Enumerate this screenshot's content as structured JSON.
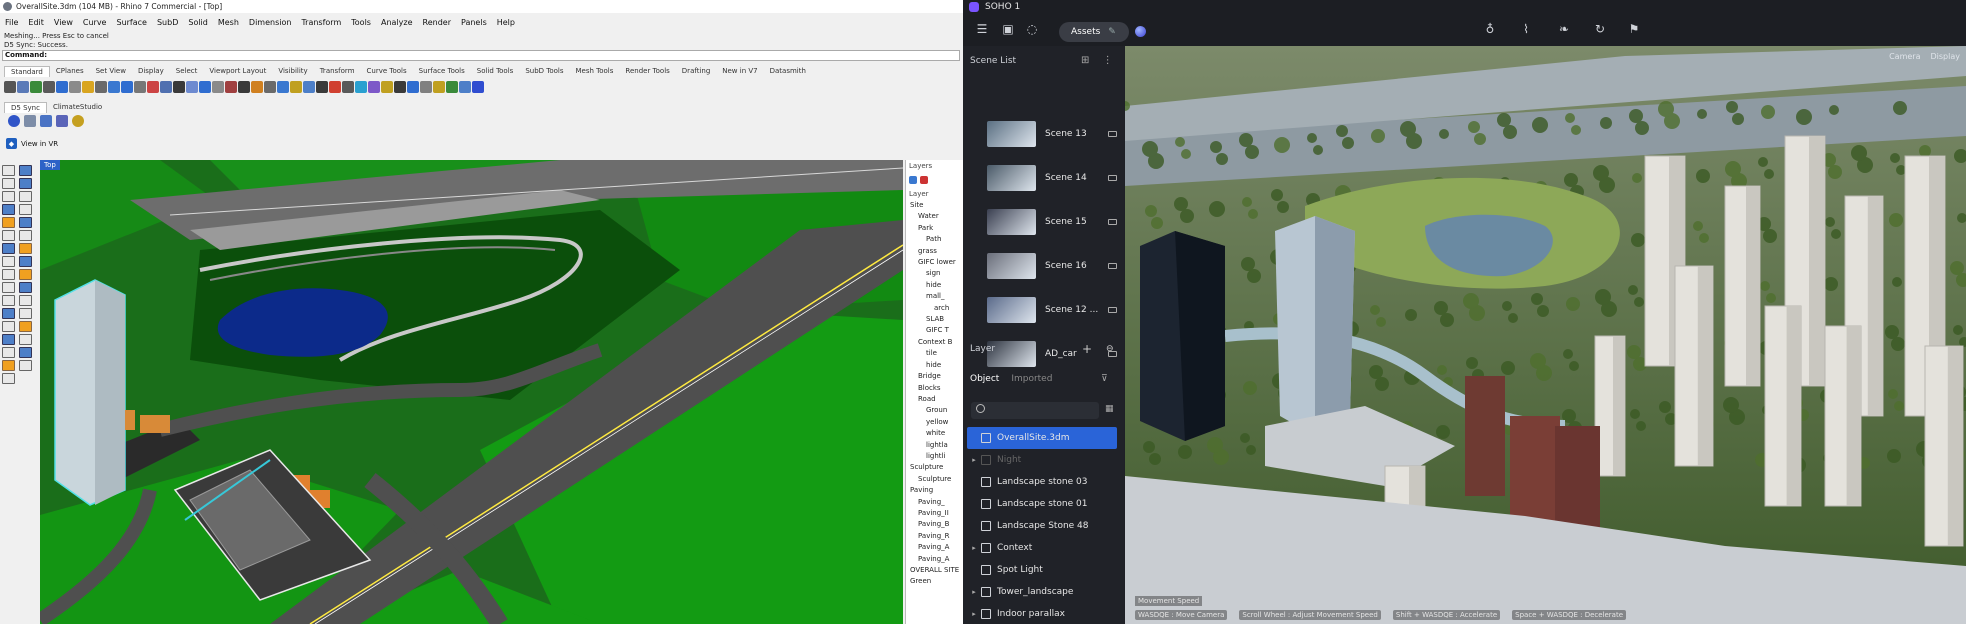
{
  "rhino": {
    "title": "OverallSite.3dm (104 MB) - Rhino 7 Commercial - [Top]",
    "menu": [
      "File",
      "Edit",
      "View",
      "Curve",
      "Surface",
      "SubD",
      "Solid",
      "Mesh",
      "Dimension",
      "Transform",
      "Tools",
      "Analyze",
      "Render",
      "Panels",
      "Help"
    ],
    "history": [
      "Meshing... Press Esc to cancel",
      "D5 Sync: Success."
    ],
    "command_prompt": "Command:",
    "toolbar_tabs": [
      "Standard",
      "CPlanes",
      "Set View",
      "Display",
      "Select",
      "Viewport Layout",
      "Visibility",
      "Transform",
      "Curve Tools",
      "Surface Tools",
      "Solid Tools",
      "SubD Tools",
      "Mesh Tools",
      "Render Tools",
      "Drafting",
      "New in V7",
      "Datasmith"
    ],
    "plugin_tabs": [
      "D5 Sync",
      "ClimateStudio"
    ],
    "vr_label": "View in VR",
    "viewport_label": "Top",
    "layers_panel": {
      "title": "Layers",
      "column": "Layer",
      "rows": [
        "Site",
        "Water",
        "Park",
        "Path",
        "grass",
        "GIFC lower",
        "sign",
        "hide",
        "mall_",
        "arch",
        "SLAB",
        "GIFC T",
        "Context B",
        "tile",
        "hide",
        "Bridge",
        "Blocks",
        "Road",
        "Groun",
        "yellow",
        "white",
        "lightla",
        "lightli",
        "Sculpture",
        "Sculpture",
        "Paving",
        "Paving_",
        "Paving_II",
        "Paving_B",
        "Paving_R",
        "Paving_A",
        "Paving_A",
        "OVERALL SITE",
        "Green"
      ]
    }
  },
  "d5": {
    "app_title": "SOHO 1",
    "assets_label": "Assets",
    "scene_list_title": "Scene List",
    "scenes": [
      {
        "name": "Scene 13"
      },
      {
        "name": "Scene 14"
      },
      {
        "name": "Scene 15"
      },
      {
        "name": "Scene 16"
      },
      {
        "name": "Scene 12 ..."
      },
      {
        "name": "AD_car"
      }
    ],
    "layer_title": "Layer",
    "layer_tabs": [
      "Object",
      "Imported"
    ],
    "layers": [
      {
        "name": "OverallSite.3dm",
        "selected": true
      },
      {
        "name": "Night",
        "dim": true
      },
      {
        "name": "Landscape stone 03"
      },
      {
        "name": "Landscape stone 01"
      },
      {
        "name": "Landscape Stone 48"
      },
      {
        "name": "Context"
      },
      {
        "name": "Spot Light"
      },
      {
        "name": "Tower_landscape"
      },
      {
        "name": "Indoor parallax"
      }
    ],
    "viewport_controls": [
      "Camera",
      "Display"
    ],
    "speed_label": "Movement Speed",
    "shortcuts": [
      "WASDQE : Move Camera",
      "Scroll Wheel : Adjust Movement Speed",
      "Shift + WASDQE : Accelerate",
      "Space + WASDQE : Decelerate"
    ]
  }
}
